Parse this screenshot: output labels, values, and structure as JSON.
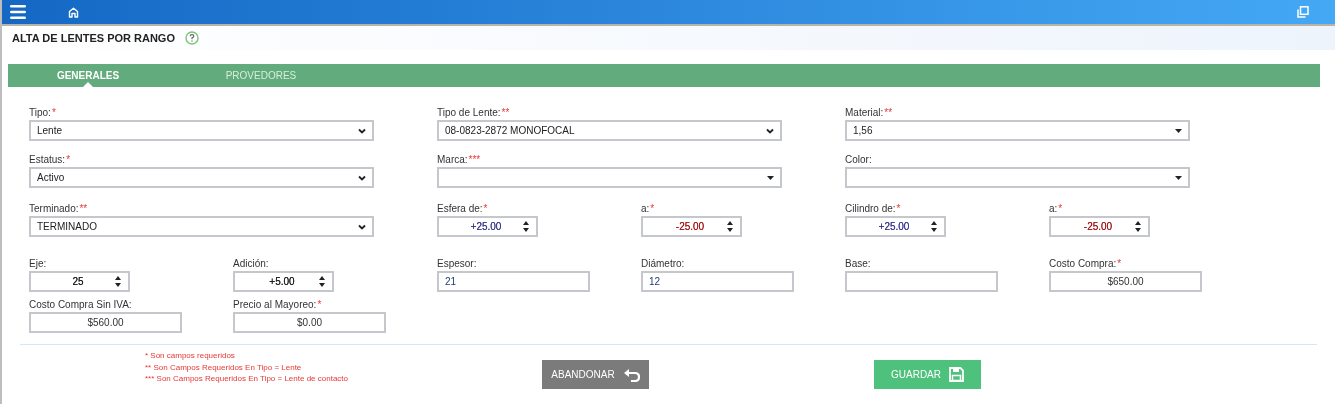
{
  "title": "ALTA DE LENTES POR RANGO",
  "tabs": [
    {
      "label": "GENERALES",
      "selected": true
    },
    {
      "label": "PROVEDORES",
      "selected": false
    }
  ],
  "form": {
    "groups": [
      {
        "fields": [
          {
            "kind": "select",
            "label": "Tipo:",
            "required": "*",
            "value": "Lente"
          },
          {
            "kind": "select",
            "label": "Tipo de Lente:",
            "required": "**",
            "value": "08-0823-2872 MONOFOCAL"
          },
          {
            "kind": "combo",
            "label": "Material:",
            "required": "**",
            "value": "1,56"
          }
        ]
      },
      {
        "fields": [
          {
            "kind": "select",
            "label": "Estatus:",
            "required": "*",
            "value": "Activo"
          },
          {
            "kind": "combo",
            "label": "Marca:",
            "required": "***"
          },
          {
            "kind": "combo",
            "label": "Color:"
          }
        ]
      },
      {
        "fields": [
          {
            "kind": "select",
            "label": "Terminado:",
            "required": "**",
            "value": "TERMINADO"
          },
          {
            "kind": "spinner",
            "label": "Esfera de:",
            "required": "*",
            "value": "+25.00",
            "color": "#3c3c8c"
          },
          {
            "kind": "spinner",
            "label": "a:",
            "required": "*",
            "value": "-25.00",
            "color": "#a41c1c"
          },
          {
            "kind": "spinner",
            "label": "Cilindro de:",
            "required": "*",
            "value": "+25.00",
            "color": "#3c3c8c"
          },
          {
            "kind": "spinner",
            "label": "a:",
            "required": "*",
            "value": "-25.00",
            "color": "#a41c1c"
          }
        ]
      },
      {
        "fields": [
          {
            "kind": "spinner",
            "label": "Eje:",
            "value": "25"
          },
          {
            "kind": "spinner",
            "label": "Adición:",
            "value": "+5.00"
          },
          {
            "kind": "text",
            "label": "Espesor:",
            "value": "21"
          },
          {
            "kind": "text",
            "label": "Diámetro:",
            "value": "12"
          },
          {
            "kind": "text",
            "label": "Base:"
          },
          {
            "kind": "amount",
            "label": "Costo Compra:",
            "required": "*",
            "value": "$650.00"
          }
        ]
      },
      {
        "fields": [
          {
            "kind": "amount",
            "label": "Costo Compra Sin IVA:",
            "value": "$560.00"
          },
          {
            "kind": "amount",
            "label": "Precio al Mayoreo:",
            "required": "*",
            "value": "$0.00"
          }
        ]
      }
    ]
  },
  "notes": [
    "* Son campos requeridos",
    "** Son Campos Requeridos En Tipo = Lente",
    "*** Son Campos Requeridos En Tipo = Lente de contacto"
  ],
  "buttons": [
    {
      "label": "ABANDONAR",
      "kind": "cancel"
    },
    {
      "label": "GUARDAR",
      "kind": "save"
    }
  ]
}
